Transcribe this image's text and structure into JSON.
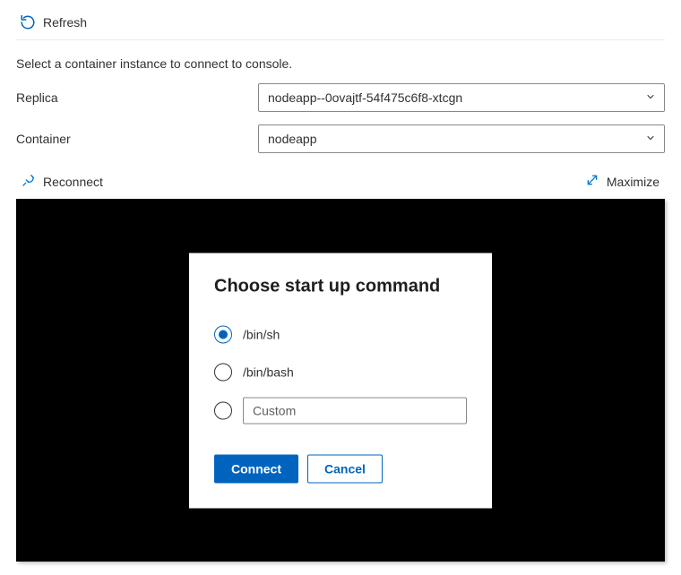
{
  "toolbar": {
    "refresh_label": "Refresh"
  },
  "instructions": "Select a container instance to connect to console.",
  "fields": {
    "replica_label": "Replica",
    "replica_value": "nodeapp--0ovajtf-54f475c6f8-xtcgn",
    "container_label": "Container",
    "container_value": "nodeapp"
  },
  "console": {
    "reconnect_label": "Reconnect",
    "maximize_label": "Maximize"
  },
  "dialog": {
    "title": "Choose start up command",
    "options": {
      "binsh": "/bin/sh",
      "binbash": "/bin/bash",
      "custom_placeholder": "Custom"
    },
    "connect_label": "Connect",
    "cancel_label": "Cancel"
  }
}
